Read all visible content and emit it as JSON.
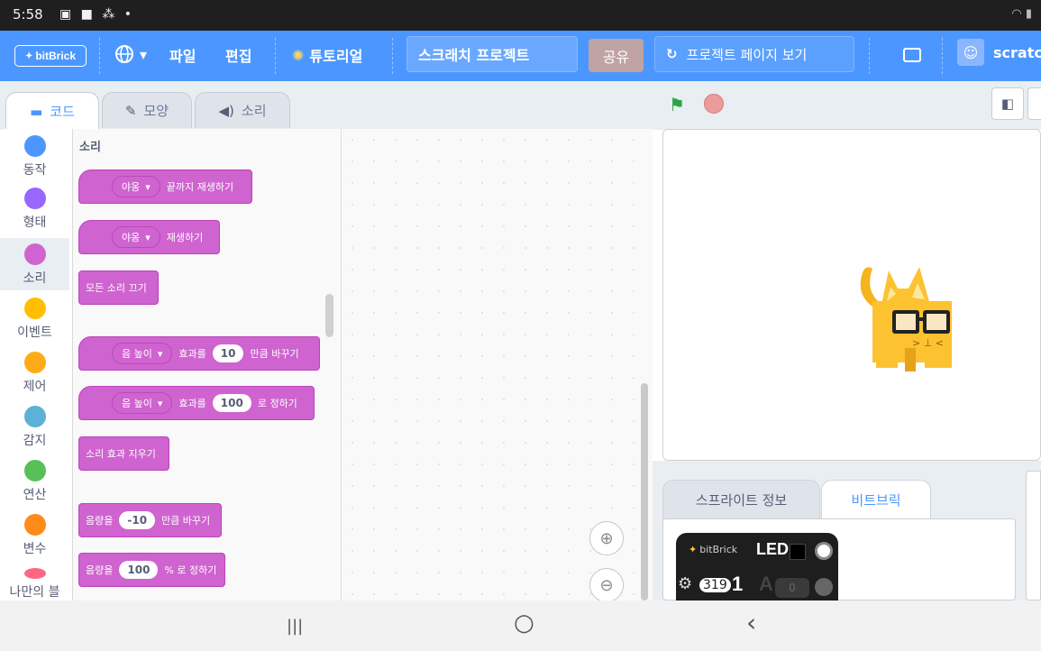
{
  "status_bar": {
    "time": "5:58",
    "notification_icons": "▣ ■ ⁂ •",
    "right_icons": "◠ ▮"
  },
  "menubar": {
    "logo_text": "bitBrick",
    "language_caret": "▾",
    "file": "파일",
    "edit": "편집",
    "tutorials": "튜토리얼",
    "project_title": "스크래치 프로젝트",
    "share": "공유",
    "project_page": "프로젝트 페이지 보기",
    "user": "scratc"
  },
  "tabs": {
    "code": "코드",
    "costumes": "모양",
    "sounds": "소리"
  },
  "categories": [
    {
      "label": "동작",
      "color": "#4c97ff"
    },
    {
      "label": "형태",
      "color": "#9966ff"
    },
    {
      "label": "소리",
      "color": "#cf63cf"
    },
    {
      "label": "이벤트",
      "color": "#ffbf00"
    },
    {
      "label": "제어",
      "color": "#ffab19"
    },
    {
      "label": "감지",
      "color": "#5cb1d6"
    },
    {
      "label": "연산",
      "color": "#59c059"
    },
    {
      "label": "변수",
      "color": "#ff8c1a"
    },
    {
      "label": "나만의 블",
      "color": "#ff6680"
    }
  ],
  "palette": {
    "section_title": "소리",
    "blocks": {
      "play_until_done": {
        "dropdown": "야옹",
        "text": "끝까지 재생하기"
      },
      "start_sound": {
        "dropdown": "야옹",
        "text": "재생하기"
      },
      "stop_all": {
        "text": "모든 소리 끄기"
      },
      "change_effect": {
        "dropdown": "음 높이",
        "text_a": "효과를",
        "value": "10",
        "text_b": "만큼 바꾸기"
      },
      "set_effect": {
        "dropdown": "음 높이",
        "text_a": "효과를",
        "value": "100",
        "text_b": "로 정하기"
      },
      "clear_effects": {
        "text": "소리 효과 지우기"
      },
      "change_volume": {
        "text_a": "음량을",
        "value": "-10",
        "text_b": "만큼 바꾸기"
      },
      "set_volume": {
        "text_a": "음량을",
        "value": "100",
        "text_b": "% 로 정하기"
      }
    }
  },
  "zoom": {
    "in": "⊕",
    "out": "⊖"
  },
  "stage": {
    "controls_flag": "⚑"
  },
  "panel_tabs": {
    "sprite_info": "스프라이트 정보",
    "bitbrick": "비트브릭"
  },
  "bitbrick_card": {
    "brand": "bitBrick",
    "led_label": "LED",
    "sensor_value": "319",
    "channel": "1",
    "analog_label": "A",
    "analog_value": "0"
  },
  "nav": {
    "recents": "|||",
    "home": "○",
    "back": "‹"
  },
  "colors": {
    "menubar": "#4c97ff",
    "sound_block": "#cf63cf",
    "cat_orange": "#ffab19"
  }
}
